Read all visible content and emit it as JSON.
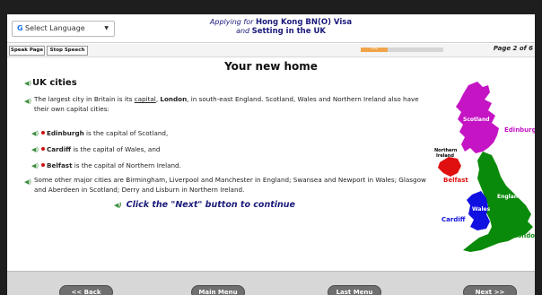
{
  "header": {
    "language": {
      "icon": "google-g-icon",
      "g": "G",
      "label": "Select Language",
      "caret": "▼"
    },
    "title_prefix": "Applying for ",
    "title_main": "Hong Kong BN(O) Visa",
    "title_line2_prefix": "and ",
    "title_line2_main": "Setting in the UK"
  },
  "toolbar": {
    "speak_page": "Speak Page",
    "stop_speech": "Stop Speech",
    "progress_fraction": 0.33,
    "progress_label": "33%",
    "page_indicator": "Page 2 of 6"
  },
  "content": {
    "heading": "Your new home",
    "section_title": "UK cities",
    "speaker_icon": "speaker-icon",
    "intro_before": "The largest city in Britain is its ",
    "intro_link": "capital",
    "intro_comma": ", ",
    "intro_bold": "London",
    "intro_after": ", in south-east England. Scotland, Wales and Northern Ireland also have their own capital cities:",
    "bullets": [
      {
        "bold": "Edinburgh",
        "rest": " is the capital of Scotland,"
      },
      {
        "bold": "Cardiff",
        "rest": " is the capital of Wales, and"
      },
      {
        "bold": "Belfast",
        "rest": " is the capital of Northern Ireland."
      }
    ],
    "other_cities": "Some other major cities are Birmingham, Liverpool and Manchester in England; Swansea and Newport in Wales; Glasgow and Aberdeen in Scotland; Derry and Lisburn in Northern Ireland.",
    "cta": "Click the \"Next\" button to continue"
  },
  "map": {
    "labels": {
      "scotland": "Scotland",
      "edinburgh": "Edinburgh",
      "northern_ireland_1": "Northern",
      "northern_ireland_2": "Ireland",
      "belfast": "Belfast",
      "england": "England",
      "wales": "Wales",
      "cardiff": "Cardiff",
      "london": "London"
    },
    "colors": {
      "scotland": "#c414c4",
      "northern_ireland": "#e01010",
      "england": "#0a8a0a",
      "wales": "#1010e0",
      "edinburgh_label": "#c414c4",
      "belfast_label": "#e01010",
      "cardiff_label": "#1010e0",
      "london_label": "#0a8a0a"
    }
  },
  "footer": {
    "back": "<< Back",
    "main_menu": "Main Menu",
    "last_menu": "Last Menu",
    "next": "Next >>"
  }
}
